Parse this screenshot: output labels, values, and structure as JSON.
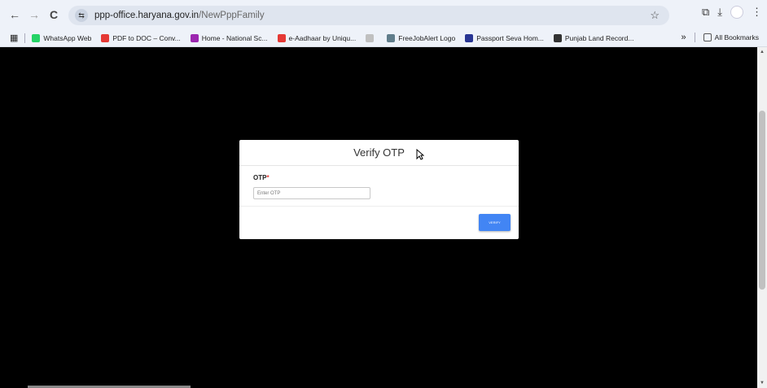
{
  "browser": {
    "url_host": "ppp-office.haryana.gov.in",
    "url_path": "/NewPppFamily",
    "back_icon": "←",
    "forward_icon": "→",
    "reload_icon": "C",
    "site_info_icon": "⇆",
    "star_icon": "☆",
    "extensions_icon": "⧉",
    "download_icon": "⤓",
    "menu_icon": "⋮"
  },
  "bookmarks": {
    "apps_icon": "▦",
    "items": [
      {
        "label": "WhatsApp Web",
        "color": "#25d366"
      },
      {
        "label": "PDF to DOC – Conv...",
        "color": "#e53935"
      },
      {
        "label": "Home - National Sc...",
        "color": "#9c27b0"
      },
      {
        "label": "e-Aadhaar by Uniqu...",
        "color": "#e53935"
      },
      {
        "label": "",
        "color": "#c0c0c0"
      },
      {
        "label": "FreeJobAlert Logo",
        "color": "#607d8b"
      },
      {
        "label": "Passport Seva Hom...",
        "color": "#283593"
      },
      {
        "label": "Punjab Land Record...",
        "color": "#333333"
      }
    ],
    "more_label": "»",
    "all_bookmarks_label": "All Bookmarks"
  },
  "modal": {
    "title": "Verify OTP",
    "otp_label": "OTP",
    "required_mark": "*",
    "otp_placeholder": "Enter OTP",
    "verify_label": "VERIFY"
  }
}
